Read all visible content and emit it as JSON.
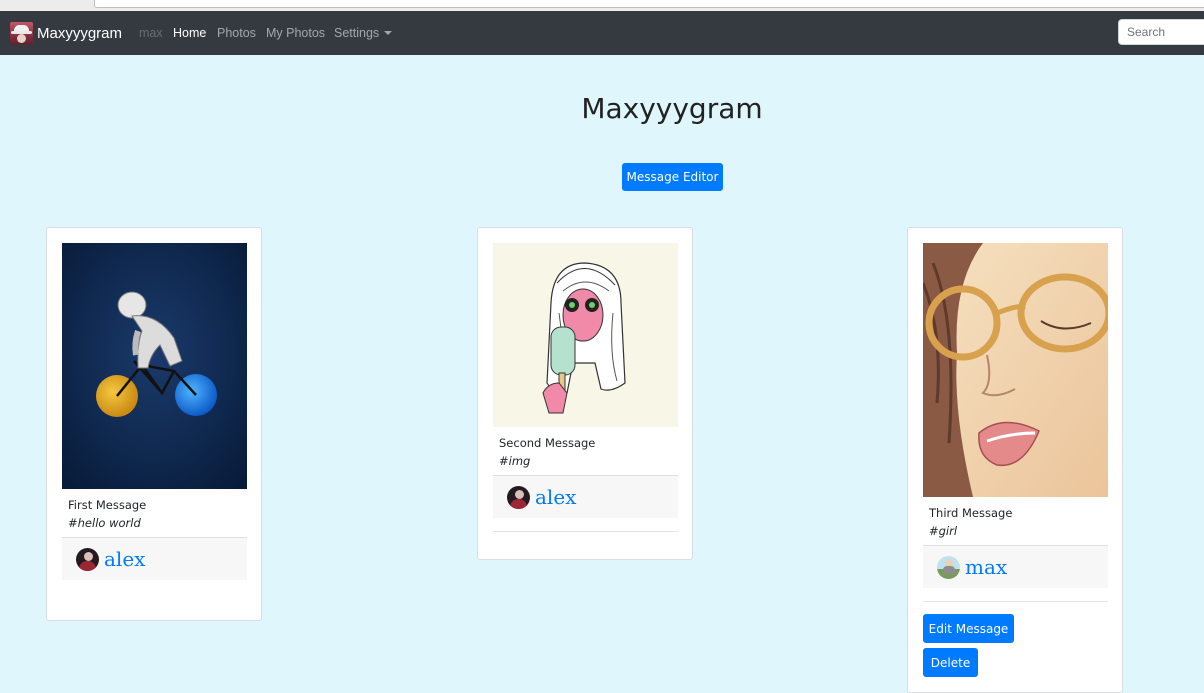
{
  "navbar": {
    "brand": "Maxyyygram",
    "user": "max",
    "links": [
      "Home",
      "Photos",
      "My Photos",
      "Settings"
    ],
    "search_placeholder": "Search"
  },
  "page": {
    "title": "Maxyyygram",
    "editor_button": "Message Editor"
  },
  "cards": [
    {
      "title": "First Message",
      "tag": "#hello world",
      "author": "alex"
    },
    {
      "title": "Second Message",
      "tag": "#img",
      "author": "alex"
    },
    {
      "title": "Third Message",
      "tag": "#girl",
      "author": "max",
      "actions": [
        "Edit Message",
        "Delete"
      ]
    }
  ],
  "colors": {
    "accent": "#007bff",
    "navbar": "#343a40",
    "background": "#dff7fc"
  }
}
